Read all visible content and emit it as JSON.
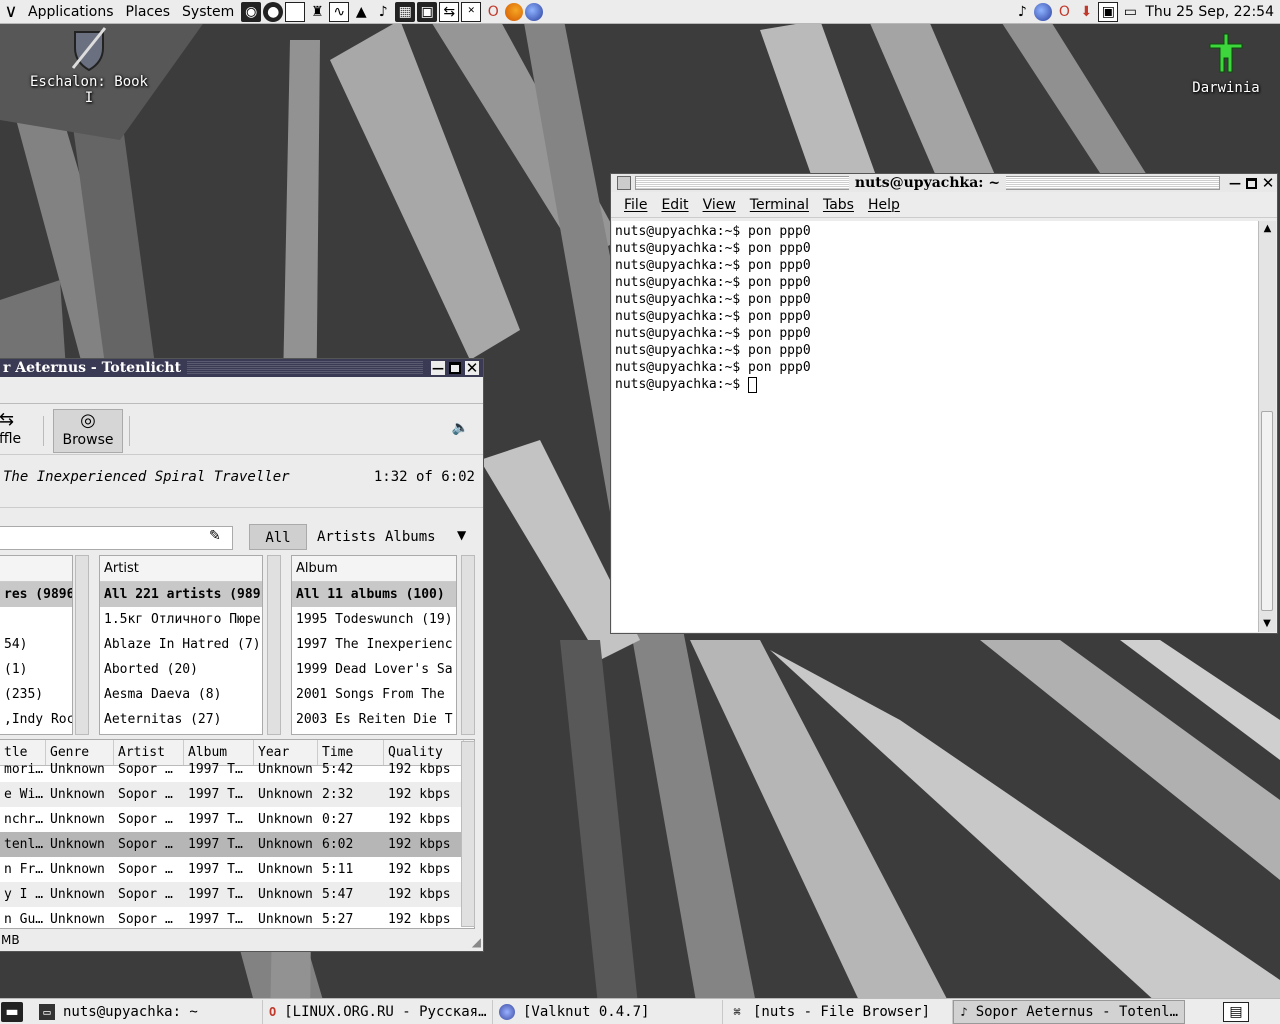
{
  "top_panel": {
    "menus": [
      "Applications",
      "Places",
      "System"
    ],
    "clock": "Thu 25 Sep, 22:54"
  },
  "desktop": {
    "icons": [
      {
        "label": "Eschalon: Book I",
        "icon": "shield-sword-icon"
      },
      {
        "label": "Darwinia",
        "icon": "darwinian-icon"
      }
    ]
  },
  "terminal": {
    "title": "nuts@upyachka: ~",
    "menu": [
      "File",
      "Edit",
      "View",
      "Terminal",
      "Tabs",
      "Help"
    ],
    "lines": [
      "nuts@upyachka:~$ pon ppp0",
      "nuts@upyachka:~$ pon ppp0",
      "nuts@upyachka:~$ pon ppp0",
      "nuts@upyachka:~$ pon ppp0",
      "nuts@upyachka:~$ pon ppp0",
      "nuts@upyachka:~$ pon ppp0",
      "nuts@upyachka:~$ pon ppp0",
      "nuts@upyachka:~$ pon ppp0",
      "nuts@upyachka:~$ pon ppp0"
    ],
    "prompt": "nuts@upyachka:~$ "
  },
  "player": {
    "title": "r Aeternus - Totenlicht",
    "toolbar": {
      "shuffle_label": "ffle",
      "browse_label": "Browse"
    },
    "now_playing": "The Inexperienced Spiral Traveller",
    "position": "1:32 of 6:02",
    "filters": [
      "All",
      "Artists",
      "Albums"
    ],
    "genre_pane": {
      "rows": [
        "res (9896",
        "",
        "54)",
        " (1)",
        " (235)",
        ",Indy Roc"
      ]
    },
    "artist_pane": {
      "header": "Artist",
      "rows": [
        "All 221 artists (989",
        "1.5кг Отличного Пюре",
        "Ablaze In Hatred (7)",
        "Aborted (20)",
        "Aesma Daeva (8)",
        "Aeternitas (27)"
      ]
    },
    "album_pane": {
      "header": "Album",
      "rows": [
        "All 11 albums (100)",
        "1995 Todeswunch (19)",
        "1997 The Inexperienc",
        "1999 Dead Lover's Sa",
        "2001 Songs From The",
        "2003 Es Reiten Die T"
      ]
    },
    "tracks": {
      "columns": [
        "tle",
        "Genre",
        "Artist",
        "Album",
        "Year",
        "Time",
        "Quality"
      ],
      "rows": [
        [
          "mori…",
          "Unknown",
          "Sopor …",
          "1997 T…",
          "Unknown",
          "5:42",
          "192 kbps"
        ],
        [
          "e Wi…",
          "Unknown",
          "Sopor …",
          "1997 T…",
          "Unknown",
          "2:32",
          "192 kbps"
        ],
        [
          "nchr…",
          "Unknown",
          "Sopor …",
          "1997 T…",
          "Unknown",
          "0:27",
          "192 kbps"
        ],
        [
          "tenl…",
          "Unknown",
          "Sopor …",
          "1997 T…",
          "Unknown",
          "6:02",
          "192 kbps"
        ],
        [
          "n Fr…",
          "Unknown",
          "Sopor …",
          "1997 T…",
          "Unknown",
          "5:11",
          "192 kbps"
        ],
        [
          "y I …",
          "Unknown",
          "Sopor …",
          "1997 T…",
          "Unknown",
          "5:47",
          "192 kbps"
        ],
        [
          "n Gu…",
          "Unknown",
          "Sopor …",
          "1997 T…",
          "Unknown",
          "5:27",
          "192 kbps"
        ]
      ],
      "selected_index": 3
    },
    "status": "MB"
  },
  "taskbar": {
    "tasks": [
      {
        "label": "nuts@upyachka: ~",
        "icon": "terminal-icon"
      },
      {
        "label": "[LINUX.ORG.RU - Русская…",
        "icon": "opera-icon"
      },
      {
        "label": "[Valknut 0.4.7]",
        "icon": "valknut-icon"
      },
      {
        "label": "[nuts - File Browser]",
        "icon": "file-browser-icon"
      },
      {
        "label": "Sopor Aeternus - Totenl…",
        "icon": "music-note-icon"
      }
    ]
  }
}
